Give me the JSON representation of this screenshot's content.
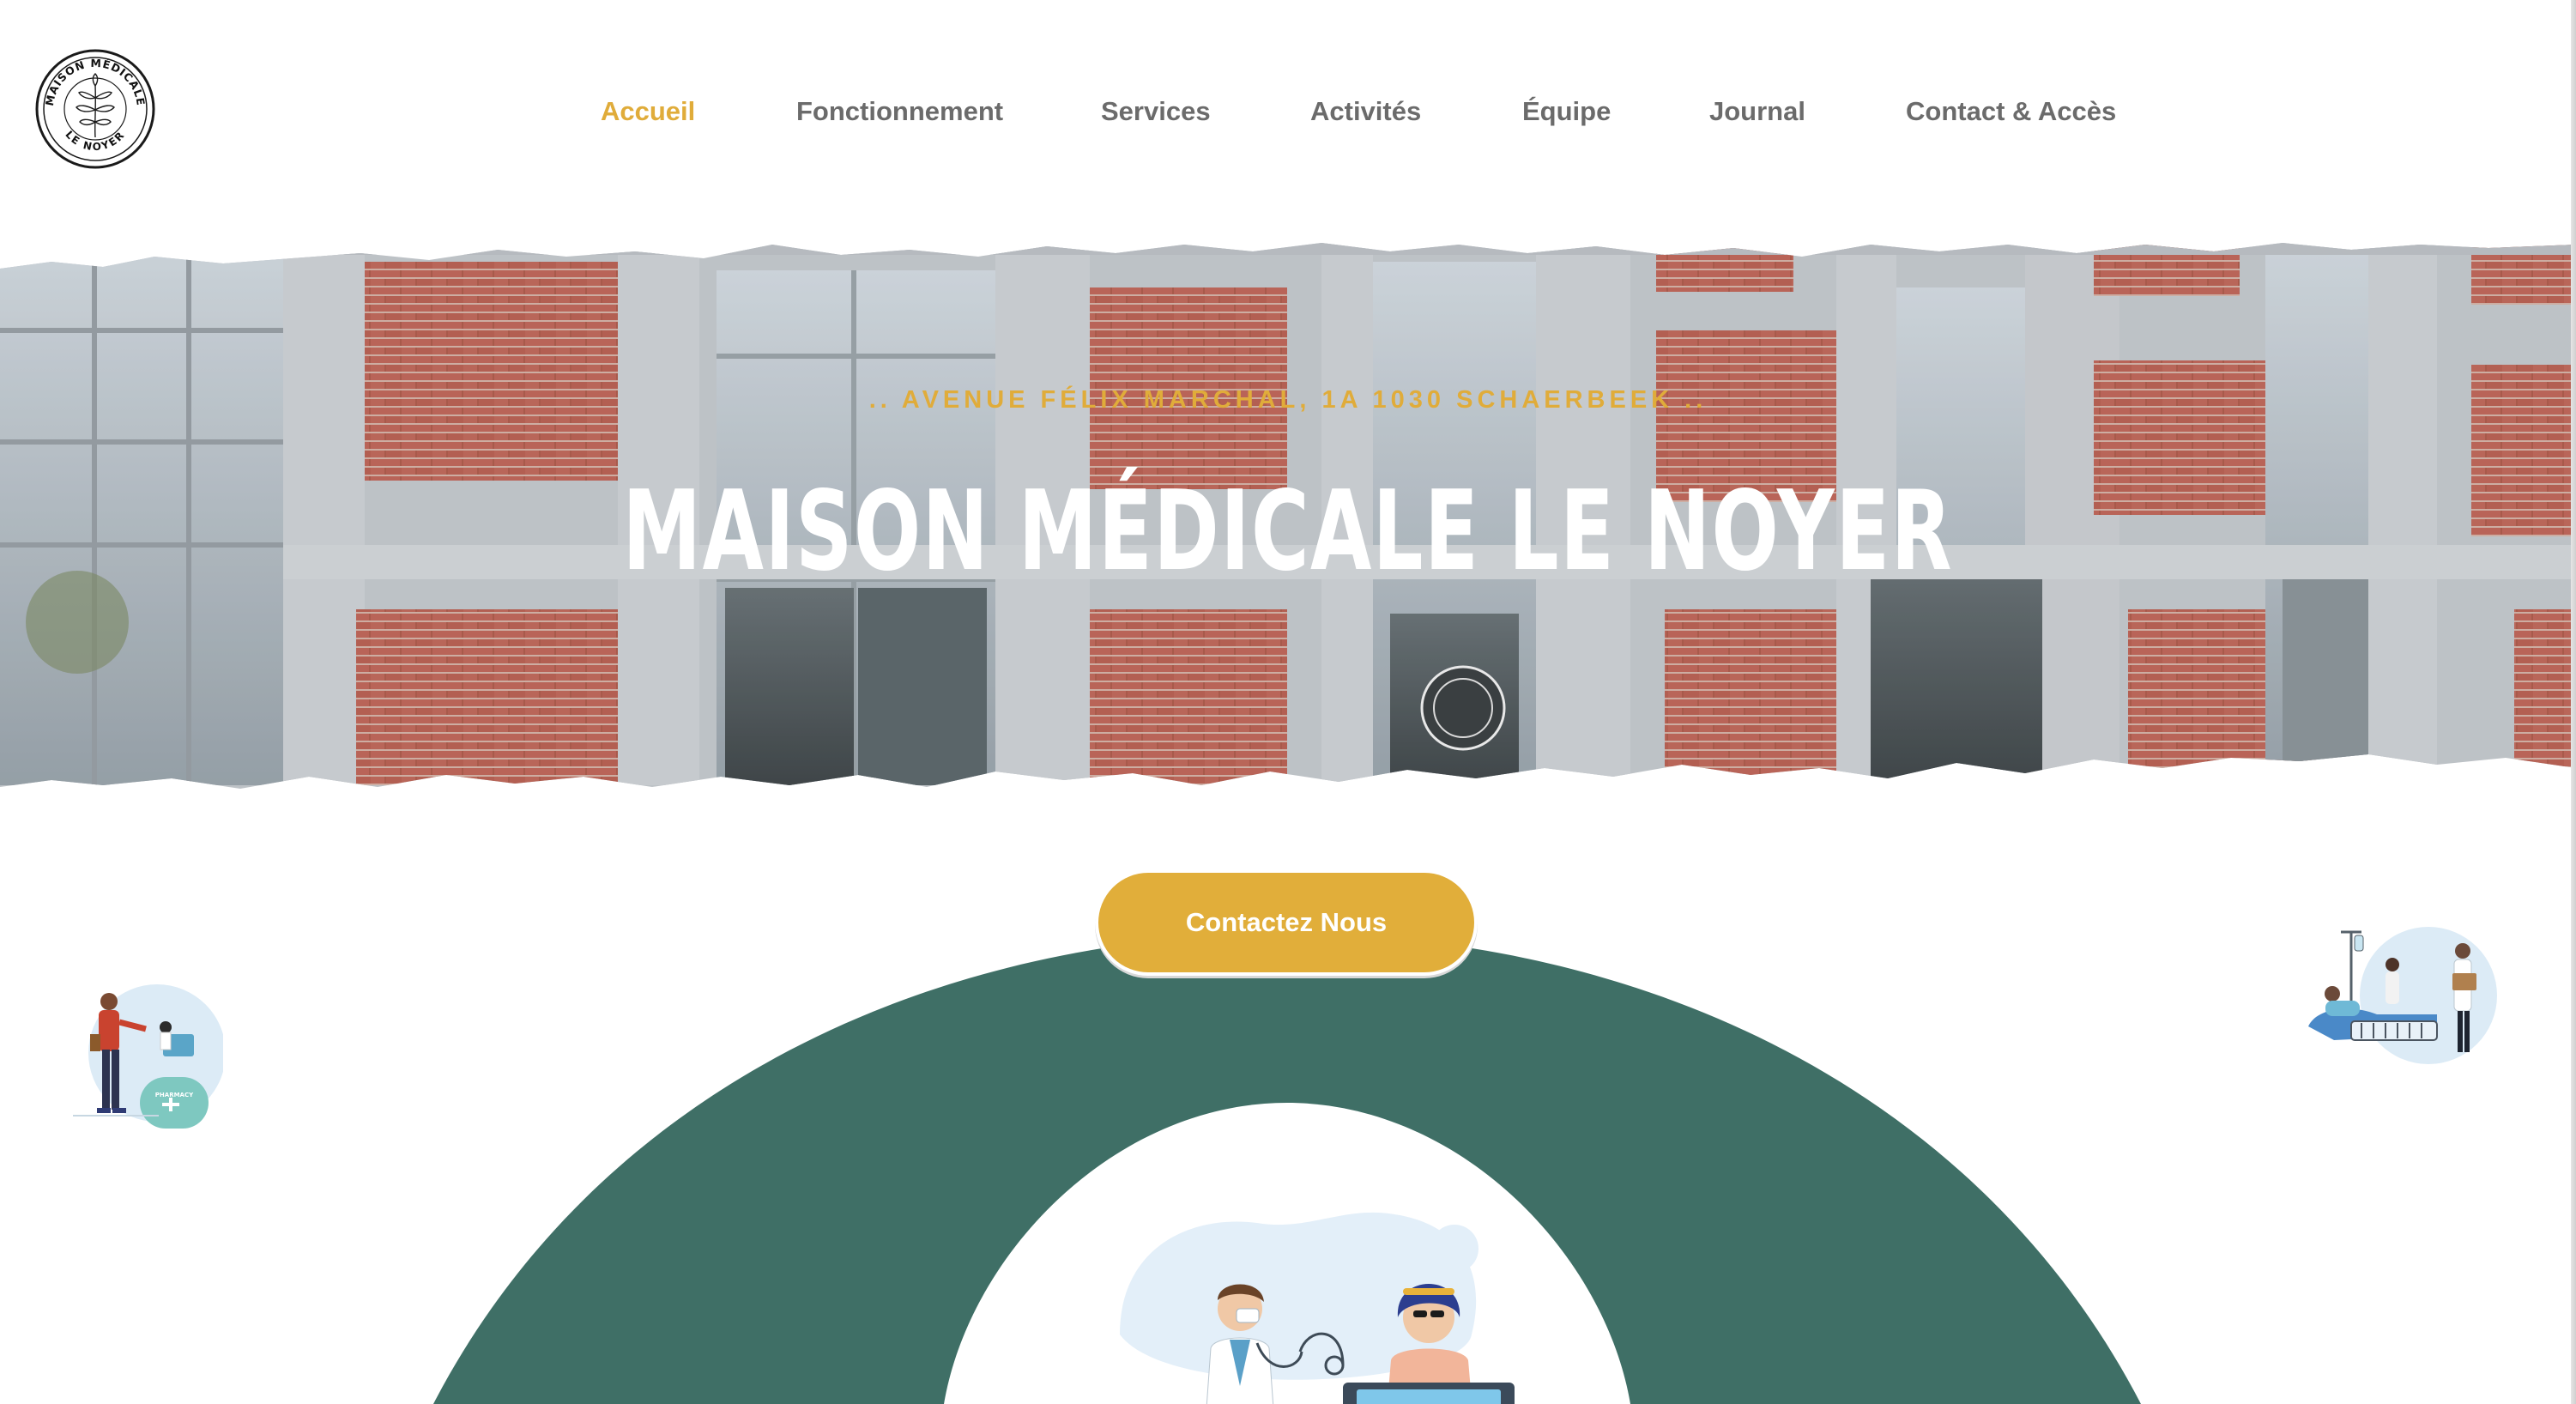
{
  "header": {
    "logo": {
      "icon": "walnut-leaf-seal",
      "text_top": "MAISON MÉDICALE",
      "text_bottom": "LE NOYER"
    },
    "nav": [
      {
        "label": "Accueil",
        "active": true
      },
      {
        "label": "Fonctionnement",
        "active": false
      },
      {
        "label": "Services",
        "active": false
      },
      {
        "label": "Activités",
        "active": false
      },
      {
        "label": "Équipe",
        "active": false
      },
      {
        "label": "Journal",
        "active": false
      },
      {
        "label": "Contact & Accès",
        "active": false
      }
    ]
  },
  "hero": {
    "image": "brick-building-facade-photo",
    "address": ".. AVENUE FÉLIX MARCHAL, 1A 1030 SCHAERBEEK ..",
    "title": "MAISON MÉDICALE LE NOYER"
  },
  "cta": {
    "label": "Contactez Nous"
  },
  "illustrations": {
    "left": {
      "icon": "pharmacy-counter-illustration",
      "sign_text": "PHARMACY"
    },
    "right": {
      "icon": "hospital-bed-illustration"
    },
    "center": {
      "icon": "doctor-patient-illustration"
    }
  },
  "colors": {
    "accent": "#e0ac3a",
    "nav_text": "#6b6b6b",
    "arc_green": "#3f6f66",
    "white": "#ffffff"
  }
}
